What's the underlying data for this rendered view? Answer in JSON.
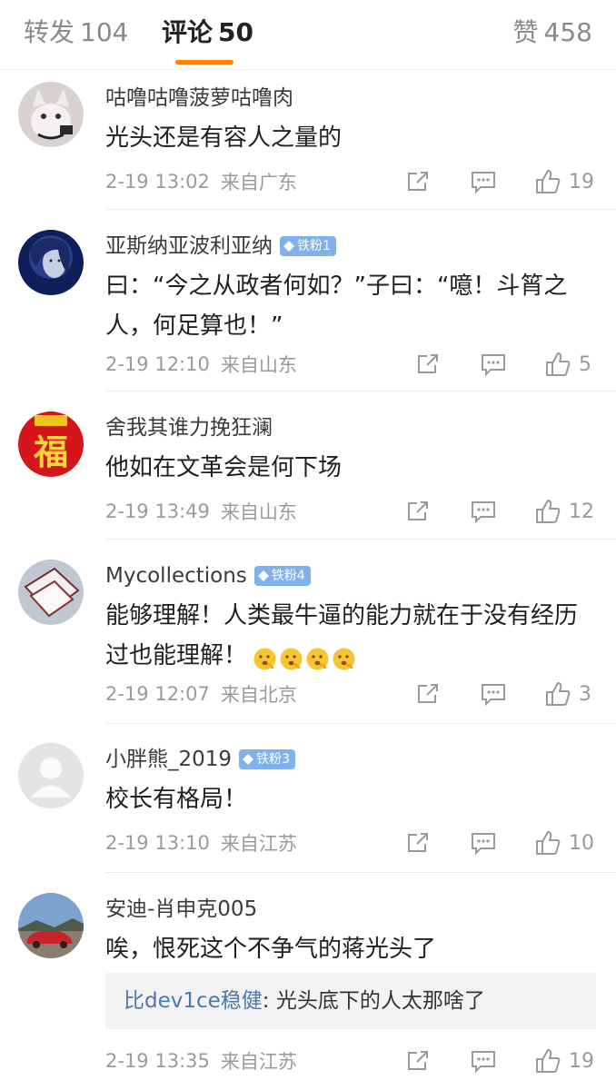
{
  "tabs": {
    "repost": {
      "label": "转发",
      "count": "104"
    },
    "comment": {
      "label": "评论",
      "count": "50"
    },
    "like": {
      "label": "赞",
      "count": "458"
    }
  },
  "comments": [
    {
      "user": "咕噜咕噜菠萝咕噜肉",
      "badge": "",
      "text": "光头还是有容人之量的",
      "time": "2-19 13:02",
      "source": "来自广东",
      "likes": "19",
      "avatar": "cat-photo"
    },
    {
      "user": "亚斯纳亚波利亚纳",
      "badge": "铁粉1",
      "text": "曰：“今之从政者何如？”子曰：“噫！斗筲之人，何足算也！”",
      "time": "2-19 12:10",
      "source": "来自山东",
      "likes": "5",
      "avatar": "woman-portrait"
    },
    {
      "user": "舍我其谁力挽狂澜",
      "badge": "",
      "text": "他如在文革会是何下场",
      "time": "2-19 13:49",
      "source": "来自山东",
      "likes": "12",
      "avatar": "fu-character-red"
    },
    {
      "user": "Mycollections",
      "badge": "铁粉4",
      "text": "能够理解！人类最牛逼的能力就在于没有经历过也能理解！",
      "emoji_count": 4,
      "emoji": "thinking-face",
      "time": "2-19 12:07",
      "source": "来自北京",
      "likes": "3",
      "avatar": "paper-cards"
    },
    {
      "user": "小胖熊_2019",
      "badge": "铁粉3",
      "text": "校长有格局！",
      "time": "2-19 13:10",
      "source": "来自江苏",
      "likes": "10",
      "avatar": "default-person"
    },
    {
      "user": "安迪-肖申克005",
      "badge": "",
      "text": "唉，恨死这个不争气的蒋光头了",
      "reply": {
        "user": "比dev1ce稳健",
        "text": ": 光头底下的人太那啥了"
      },
      "time": "2-19 13:35",
      "source": "来自江苏",
      "likes": "19",
      "avatar": "red-car-landscape"
    }
  ],
  "colors": {
    "accent": "#ff8200",
    "badge": "#7fb2ec",
    "link": "#4a78ad",
    "muted": "#9a9a9a"
  },
  "icons": {
    "share": "share-icon",
    "reply": "comment-icon",
    "like": "thumbs-up-icon"
  }
}
